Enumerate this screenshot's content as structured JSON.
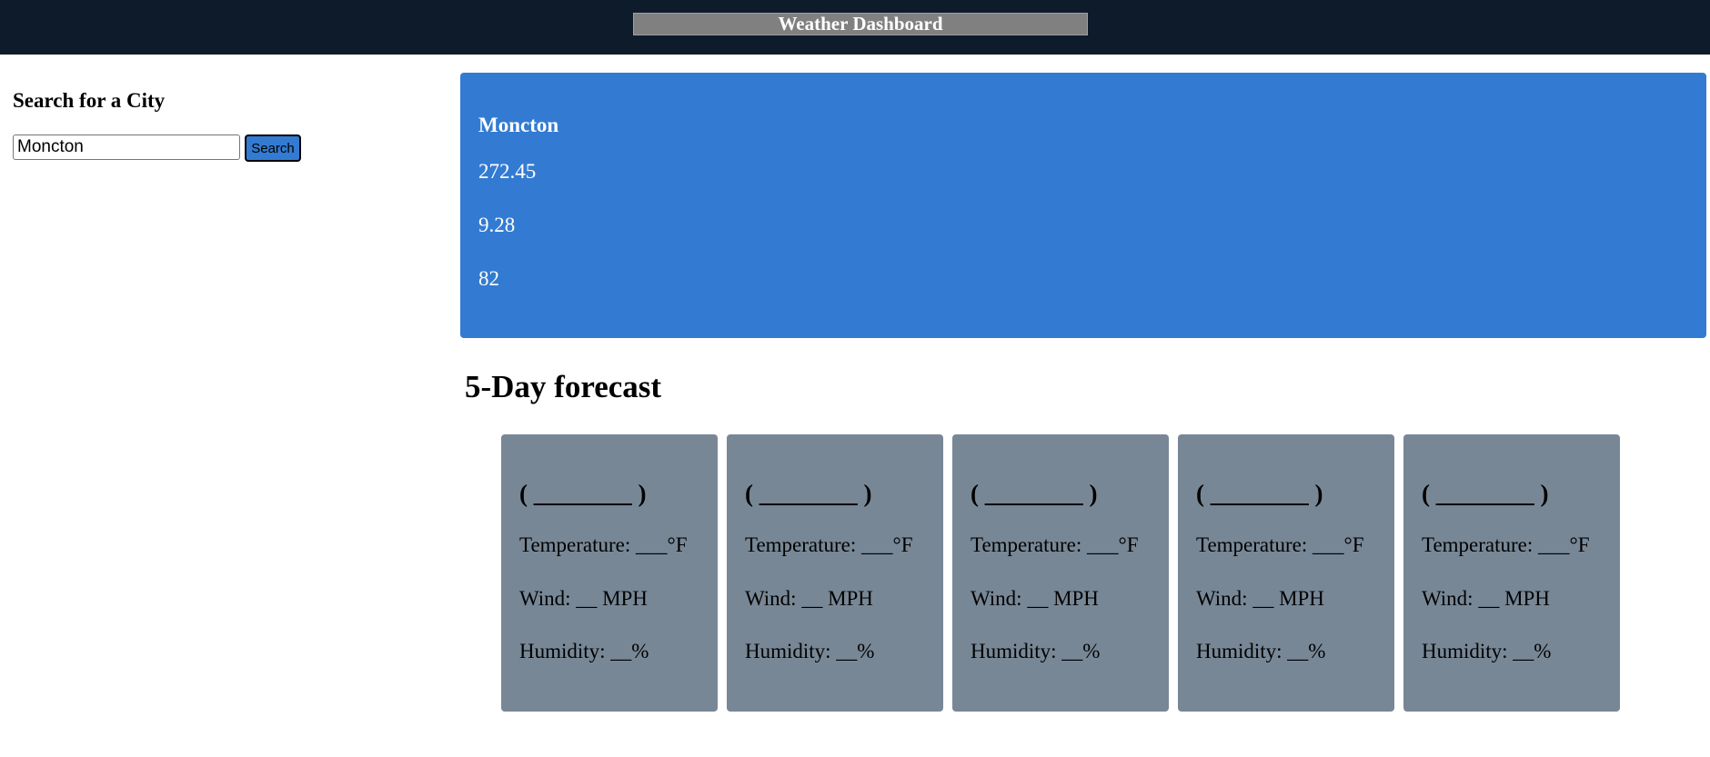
{
  "header": {
    "title": "Weather Dashboard"
  },
  "sidebar": {
    "heading": "Search for a City",
    "search": {
      "value": "Moncton",
      "button_label": "Search"
    }
  },
  "current": {
    "city": "Moncton",
    "values": [
      "272.45",
      "9.28",
      "82"
    ]
  },
  "forecast": {
    "heading": "5-Day forecast",
    "cards": [
      {
        "date": "( ________ )",
        "temperature": "Temperature: ___°F",
        "wind": "Wind: __ MPH",
        "humidity": "Humidity: __%"
      },
      {
        "date": "( ________ )",
        "temperature": "Temperature: ___°F",
        "wind": "Wind: __ MPH",
        "humidity": "Humidity: __%"
      },
      {
        "date": "( ________ )",
        "temperature": "Temperature: ___°F",
        "wind": "Wind: __ MPH",
        "humidity": "Humidity: __%"
      },
      {
        "date": "( ________ )",
        "temperature": "Temperature: ___°F",
        "wind": "Wind: __ MPH",
        "humidity": "Humidity: __%"
      },
      {
        "date": "( ________ )",
        "temperature": "Temperature: ___°F",
        "wind": "Wind: __ MPH",
        "humidity": "Humidity: __%"
      }
    ]
  },
  "colors": {
    "header_bg": "#0e1b2b",
    "title_bg": "#808080",
    "accent": "#337bd2",
    "card_bg": "#788796"
  }
}
